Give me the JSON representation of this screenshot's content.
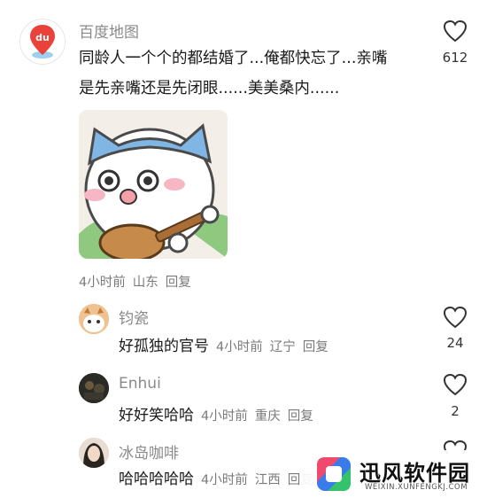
{
  "main_comment": {
    "username": "百度地图",
    "text_line1": "同龄人一个个的都结婚了...俺都快忘了...亲嘴",
    "text_line2": "是先亲嘴还是先闭眼......美美桑内......",
    "time": "4小时前",
    "location": "山东",
    "reply_label": "回复",
    "like_count": "612",
    "logo_text": "du"
  },
  "replies": [
    {
      "username": "钧瓷",
      "text": "好孤独的官号",
      "time": "4小时前",
      "location": "辽宁",
      "reply_label": "回复",
      "like_count": "24"
    },
    {
      "username": "Enhui",
      "text": "好好笑哈哈",
      "time": "4小时前",
      "location": "重庆",
      "reply_label": "回复",
      "like_count": "2"
    },
    {
      "username": "冰岛咖啡",
      "text": "哈哈哈哈哈",
      "time": "4小时前",
      "location": "江西",
      "reply_label": "回复",
      "like_count": ""
    }
  ],
  "watermark": {
    "name": "迅风软件园",
    "url": "WEIXIN.XUNFENGKJ.COM"
  },
  "colors": {
    "accent_red": "#e8423a",
    "text_primary": "#1a1a1a",
    "text_secondary": "#8a8a8a"
  }
}
